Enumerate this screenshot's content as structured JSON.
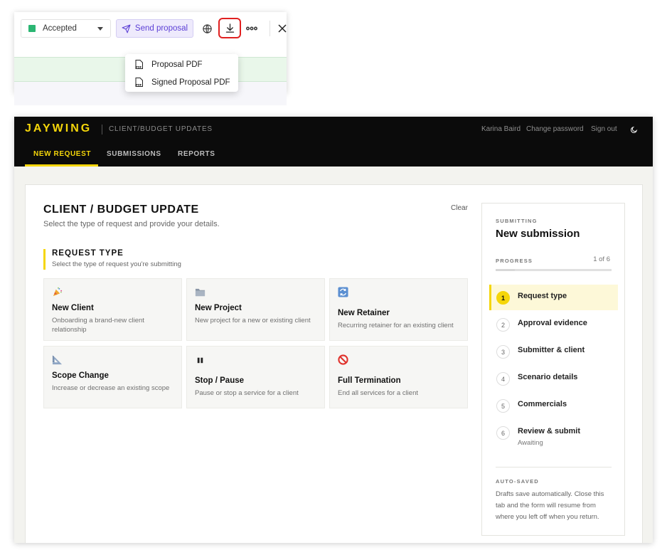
{
  "toolbar": {
    "status_label": "Accepted",
    "status_color": "#2bb673",
    "send_label": "Send proposal",
    "icons": [
      "globe-icon",
      "download-icon",
      "more-icon",
      "close-icon"
    ],
    "download_menu": [
      {
        "label": "Proposal PDF",
        "icon": "pdf-icon"
      },
      {
        "label": "Signed Proposal PDF",
        "icon": "pdf-icon"
      }
    ]
  },
  "app": {
    "logo": "JAYWING",
    "subtitle": "CLIENT/BUDGET UPDATES",
    "user_name": "Karina Baird",
    "change_password": "Change password",
    "sign_out": "Sign out",
    "accent_color": "#f5d60a",
    "tabs": [
      {
        "label": "NEW REQUEST",
        "active": true
      },
      {
        "label": "SUBMISSIONS",
        "active": false
      },
      {
        "label": "REPORTS",
        "active": false
      }
    ]
  },
  "form": {
    "title": "CLIENT / BUDGET UPDATE",
    "subtitle": "Select the type of request and provide your details.",
    "clear_label": "Clear",
    "section_title": "REQUEST TYPE",
    "section_subtitle": "Select the type of request you're submitting",
    "request_types": [
      {
        "title": "New Client",
        "desc": "Onboarding a brand-new client relationship",
        "icon": "party-popper-icon"
      },
      {
        "title": "New Project",
        "desc": "New project for a new or existing client",
        "icon": "folder-icon"
      },
      {
        "title": "New Retainer",
        "desc": "Recurring retainer for an existing client",
        "icon": "repeat-icon"
      },
      {
        "title": "Scope Change",
        "desc": "Increase or decrease an existing scope",
        "icon": "ruler-triangle-icon"
      },
      {
        "title": "Stop / Pause",
        "desc": "Pause or stop a service for a client",
        "icon": "pause-icon"
      },
      {
        "title": "Full Termination",
        "desc": "End all services for a client",
        "icon": "no-entry-icon"
      }
    ]
  },
  "progress": {
    "submitting_label": "SUBMITTING",
    "title": "New submission",
    "progress_label": "PROGRESS",
    "count": "1 of 6",
    "fraction": 0.167,
    "steps": [
      {
        "num": "1",
        "label": "Request type",
        "active": true
      },
      {
        "num": "2",
        "label": "Approval evidence"
      },
      {
        "num": "3",
        "label": "Submitter & client"
      },
      {
        "num": "4",
        "label": "Scenario details"
      },
      {
        "num": "5",
        "label": "Commercials"
      },
      {
        "num": "6",
        "label": "Review & submit",
        "sub": "Awaiting"
      }
    ],
    "autosave_label": "AUTO-SAVED",
    "autosave_note": "Drafts save automatically. Close this tab and the form will resume from where you left off when you return."
  }
}
